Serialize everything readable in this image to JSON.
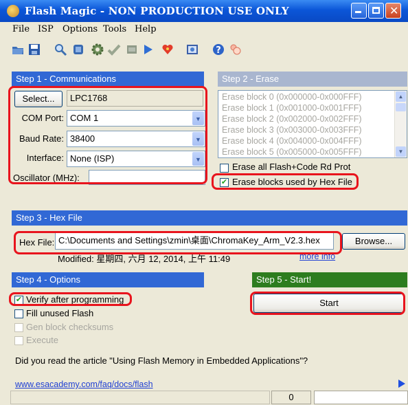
{
  "window": {
    "title": "Flash Magic - NON PRODUCTION USE ONLY"
  },
  "menu": [
    "File",
    "ISP",
    "Options",
    "Tools",
    "Help"
  ],
  "toolbar_icons": [
    "open-icon",
    "save-icon",
    "search-icon",
    "chip-icon",
    "gear-icon",
    "check-icon",
    "erase-icon",
    "play-icon",
    "heart-icon",
    "terminal-icon",
    "help-icon",
    "user-icon"
  ],
  "step1": {
    "header": "Step 1 - Communications",
    "select_label": "Select...",
    "device": "LPC1768",
    "com_port_label": "COM Port:",
    "com_port_value": "COM 1",
    "baud_label": "Baud Rate:",
    "baud_value": "38400",
    "interface_label": "Interface:",
    "interface_value": "None (ISP)",
    "oscillator_label": "Oscillator (MHz):",
    "oscillator_value": ""
  },
  "step2": {
    "header": "Step 2 - Erase",
    "blocks": [
      "Erase block 0 (0x000000-0x000FFF)",
      "Erase block 1 (0x001000-0x001FFF)",
      "Erase block 2 (0x002000-0x002FFF)",
      "Erase block 3 (0x003000-0x003FFF)",
      "Erase block 4 (0x004000-0x004FFF)",
      "Erase block 5 (0x005000-0x005FFF)"
    ],
    "erase_all_label": "Erase all Flash+Code Rd Prot",
    "erase_all_checked": false,
    "erase_used_label": "Erase blocks used by Hex File",
    "erase_used_checked": true
  },
  "step3": {
    "header": "Step 3 - Hex File",
    "hex_label": "Hex File:",
    "hex_path": "C:\\Documents and Settings\\zmin\\桌面\\ChromaKey_Arm_V2.3.hex",
    "browse_label": "Browse...",
    "modified_text": "Modified: 星期四, 六月 12, 2014, 上午 11:49",
    "more_info": "more info"
  },
  "step4": {
    "header": "Step 4 - Options",
    "options": [
      {
        "label": "Verify after programming",
        "checked": true,
        "enabled": true
      },
      {
        "label": "Fill unused Flash",
        "checked": false,
        "enabled": true
      },
      {
        "label": "Gen block checksums",
        "checked": false,
        "enabled": false
      },
      {
        "label": "Execute",
        "checked": false,
        "enabled": false
      }
    ]
  },
  "step5": {
    "header": "Step 5 - Start!",
    "start_label": "Start"
  },
  "footer": {
    "article_text": "Did you read the article \"Using Flash Memory in Embedded Applications\"?",
    "link": "www.esacademy.com/faq/docs/flash",
    "status_value": "0"
  },
  "colors": {
    "section_blue": "#3168d5",
    "section_green": "#2d7d1f",
    "highlight_red": "#e8141d"
  }
}
